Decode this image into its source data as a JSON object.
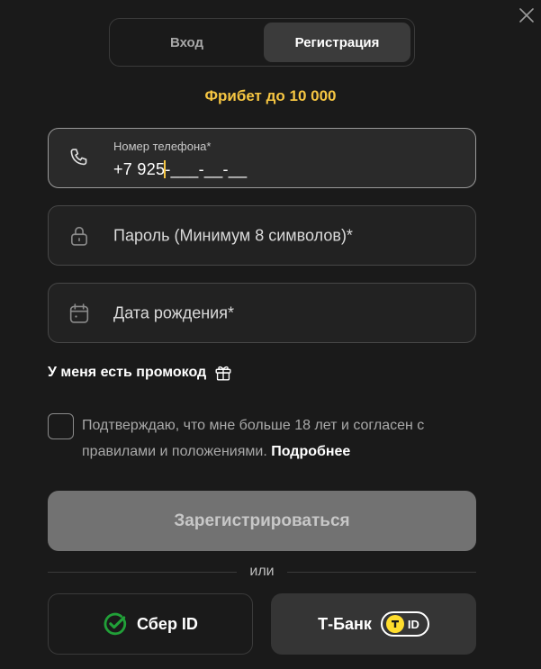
{
  "tabs": [
    {
      "label": "Вход",
      "active": false
    },
    {
      "label": "Регистрация",
      "active": true
    }
  ],
  "bonus_title": "Фрибет до 10 000",
  "phone_field": {
    "label": "Номер телефона*",
    "value_entered": "+7 925",
    "value_mask": "-___-__-__",
    "icon": "phone-icon"
  },
  "password_field": {
    "placeholder": "Пароль (Минимум 8 символов)*",
    "icon": "lock-icon"
  },
  "birthdate_field": {
    "placeholder": "Дата рождения*",
    "icon": "calendar-icon"
  },
  "promo_toggle": {
    "label": "У меня есть промокод",
    "icon": "gift-icon"
  },
  "agreement": {
    "text": "Подтверждаю, что мне больше 18 лет и согласен с правилами и положениями.",
    "link": "Подробнее",
    "checked": false
  },
  "submit_label": "Зарегистрироваться",
  "divider_label": "или",
  "social": {
    "sber_label": "Сбер ID",
    "tbank_label": "Т-Банк",
    "tbank_badge": "ID"
  },
  "colors": {
    "background": "#1a1a1a",
    "accent": "#f5c542",
    "sber_green": "#21a038",
    "tbank_yellow": "#ffdd2d"
  }
}
